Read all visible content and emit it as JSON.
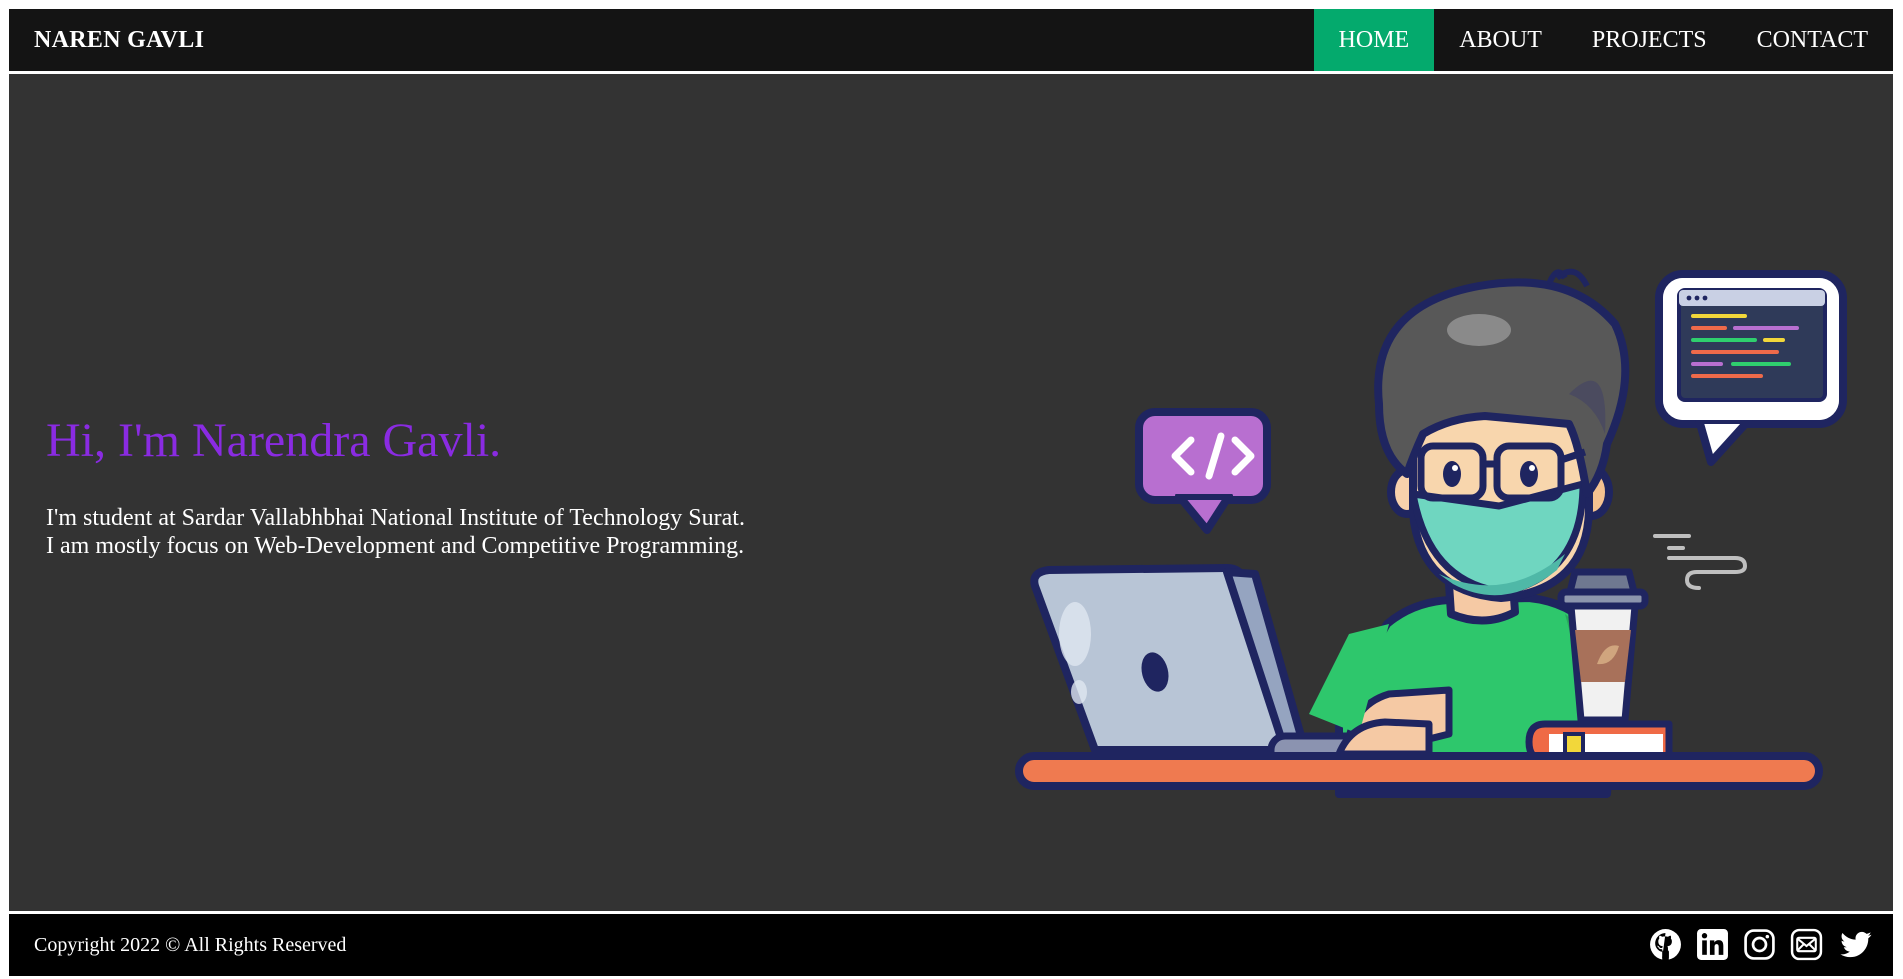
{
  "navbar": {
    "brand": "NAREN GAVLI",
    "items": [
      {
        "label": "HOME",
        "active": true
      },
      {
        "label": "ABOUT",
        "active": false
      },
      {
        "label": "PROJECTS",
        "active": false
      },
      {
        "label": "CONTACT",
        "active": false
      }
    ]
  },
  "hero": {
    "headline": "Hi, I'm Narendra Gavli.",
    "intro_line1": "I'm student at Sardar Vallabhbhai National Institute of Technology Surat.",
    "intro_line2": "I am mostly focus on Web-Development and Competitive Programming.",
    "illustration": "developer-with-laptop-illustration"
  },
  "footer": {
    "copyright": "Copyright 2022 © All Rights Reserved",
    "social_icons": [
      "github-icon",
      "linkedin-icon",
      "instagram-icon",
      "email-icon",
      "twitter-icon"
    ]
  },
  "colors": {
    "navbar_bg": "#141414",
    "active_nav": "#04aa6d",
    "hero_bg": "#333333",
    "headline": "#8a2be2",
    "footer_bg": "#000000"
  }
}
